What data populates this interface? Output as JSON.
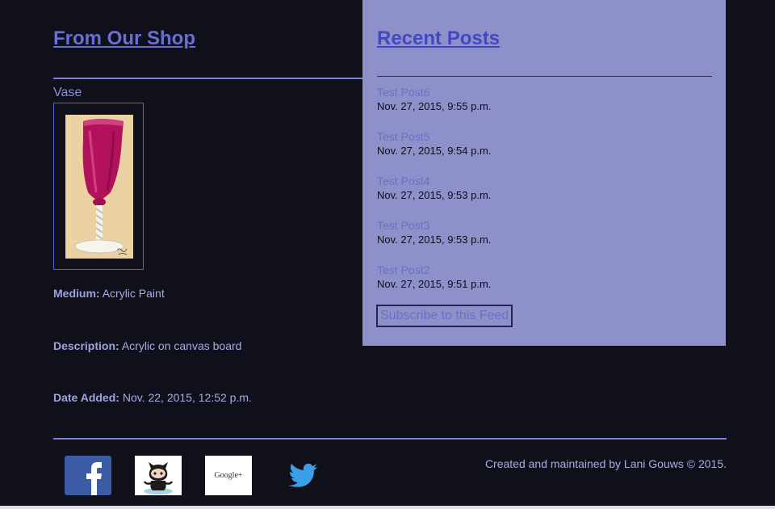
{
  "shop": {
    "heading": "From Our Shop",
    "product": {
      "name": "Vase",
      "medium_label": "Medium:",
      "medium": "Acrylic Paint",
      "description_label": "Description:",
      "description": "Acrylic on canvas board",
      "date_label": "Date Added:",
      "date": "Nov. 22, 2015, 12:52 p.m."
    }
  },
  "recent": {
    "heading": "Recent Posts",
    "posts": [
      {
        "title": "Test Post6",
        "date": "Nov. 27, 2015, 9:55 p.m."
      },
      {
        "title": "Test Post5",
        "date": "Nov. 27, 2015, 9:54 p.m."
      },
      {
        "title": "Test Post4",
        "date": "Nov. 27, 2015, 9:53 p.m."
      },
      {
        "title": "Test Post3",
        "date": "Nov. 27, 2015, 9:53 p.m."
      },
      {
        "title": "Test Post2",
        "date": "Nov. 27, 2015, 9:51 p.m."
      }
    ],
    "subscribe_label": "Subscribe to this Feed"
  },
  "footer": {
    "social": [
      {
        "icon": "facebook-icon"
      },
      {
        "icon": "github-icon"
      },
      {
        "icon": "google-plus-icon",
        "text": "Google+"
      },
      {
        "icon": "twitter-icon"
      }
    ],
    "credit": "Created and maintained by Lani Gouws © 2015."
  },
  "colors": {
    "background": "#0f1019",
    "panel": "#8e91c9",
    "link": "#6a6fd2",
    "accent_rule": "#7c80d4"
  }
}
